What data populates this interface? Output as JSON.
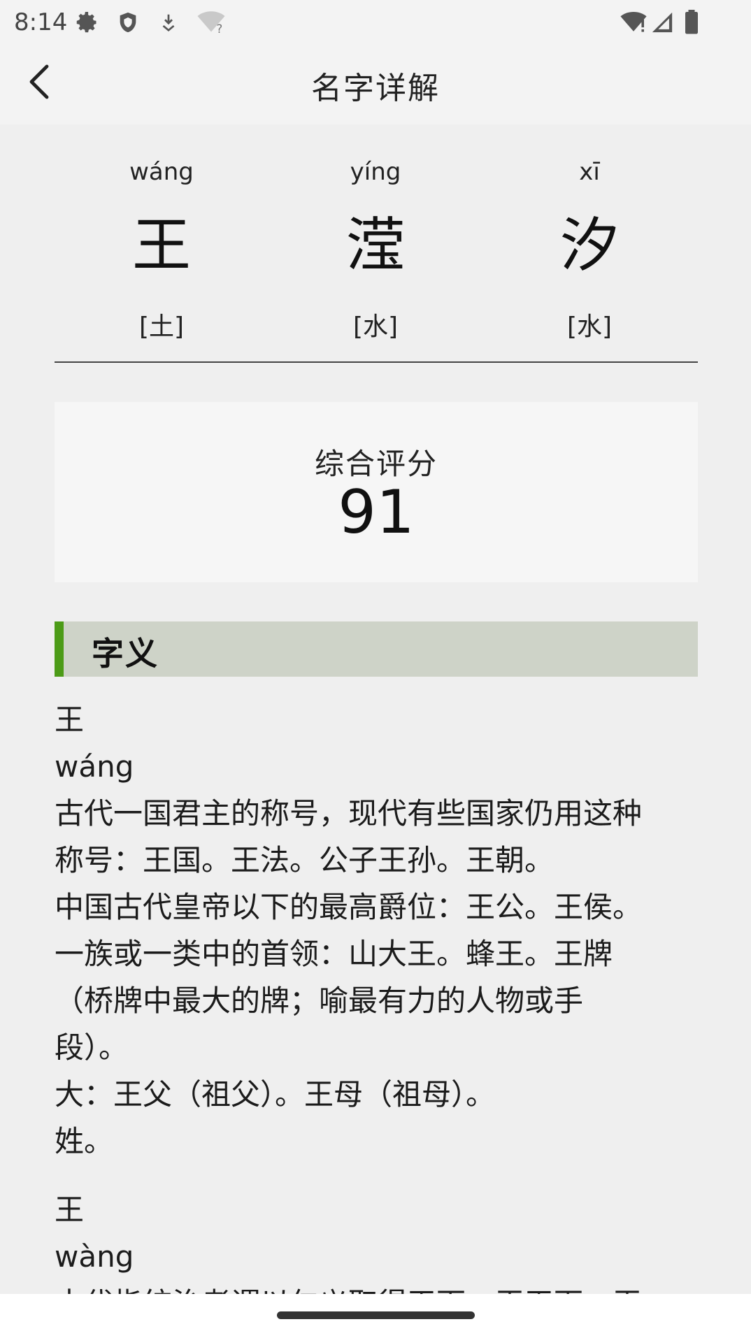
{
  "status": {
    "time": "8:14",
    "left_icons": [
      "gear-icon",
      "shield-icon",
      "download-icon",
      "wifi-question-icon"
    ],
    "right_icons": [
      "wifi-alert-icon",
      "signal-icon",
      "battery-icon"
    ]
  },
  "appbar": {
    "title": "名字详解",
    "back_icon": "chevron-left-icon"
  },
  "name": {
    "chars": [
      {
        "pinyin": "wáng",
        "hanzi": "王",
        "element": "[土]"
      },
      {
        "pinyin": "yíng",
        "hanzi": "滢",
        "element": "[水]"
      },
      {
        "pinyin": "xī",
        "hanzi": "汐",
        "element": "[水]"
      }
    ]
  },
  "score": {
    "label": "综合评分",
    "value": "91"
  },
  "section": {
    "title": "字义",
    "accent_color": "#4c9b17",
    "bg_color": "#ced3c8"
  },
  "meanings": {
    "entry1": {
      "char": "王",
      "pinyin": "wáng",
      "lines": [
        "古代一国君主的称号，现代有些国家仍用这种",
        "称号：王国。王法。公子王孙。王朝。",
        "中国古代皇帝以下的最高爵位：王公。王侯。",
        "一族或一类中的首领：山大王。蜂王。王牌",
        "（桥牌中最大的牌；喻最有力的人物或手",
        "段）。",
        "大：王父（祖父）。王母（祖母）。",
        "姓。"
      ]
    },
    "entry2": {
      "char": "王",
      "pinyin": "wàng",
      "lines": [
        "古代指统治者谓以仁义取得天下：王天下。王"
      ]
    }
  }
}
